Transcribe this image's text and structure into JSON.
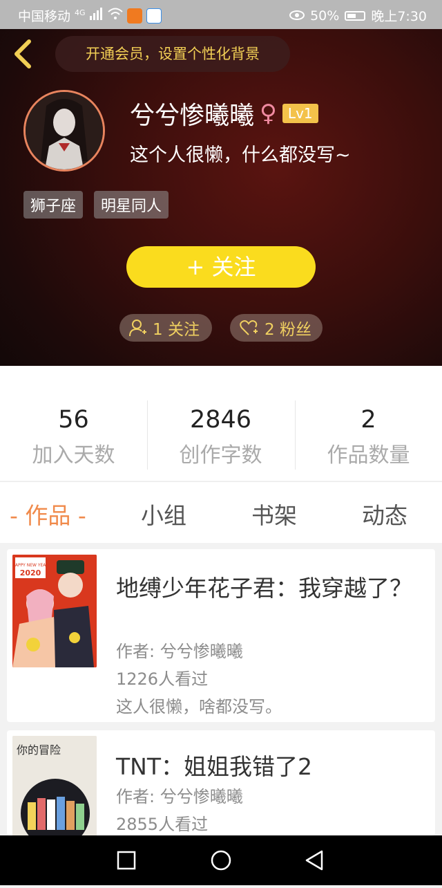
{
  "status_bar": {
    "carrier": "中国移动",
    "network": "4G",
    "battery_percent": "50%",
    "time": "晚上7:30"
  },
  "header": {
    "vip_banner": "开通会员，设置个性化背景",
    "nickname": "兮兮惨曦曦",
    "gender_symbol": "♀",
    "level": "Lv1",
    "bio": "这个人很懒，什么都没写~",
    "tags": [
      "狮子座",
      "明星同人"
    ],
    "follow_button": "+   关注",
    "following": "1 关注",
    "fans": "2 粉丝"
  },
  "stats": [
    {
      "value": "56",
      "label": "加入天数"
    },
    {
      "value": "2846",
      "label": "创作字数"
    },
    {
      "value": "2",
      "label": "作品数量"
    }
  ],
  "tabs": [
    "- 作品 -",
    "小组",
    "书架",
    "动态"
  ],
  "works": [
    {
      "title": "地缚少年花子君：我穿越了？",
      "author": "作者: 兮兮惨曦曦",
      "views": "1226人看过",
      "desc": "这人很懒，啥都没写。",
      "cover_text": "HAPPY NEW YEAR 2020"
    },
    {
      "title": "TNT：姐姐我错了2",
      "author": "作者: 兮兮惨曦曦",
      "views": "2855人看过",
      "cover_text": "你的冒险"
    }
  ],
  "colors": {
    "accent": "#f08a4b",
    "follow_yellow": "#fadc1e",
    "vip_gold": "#f2cf55"
  }
}
